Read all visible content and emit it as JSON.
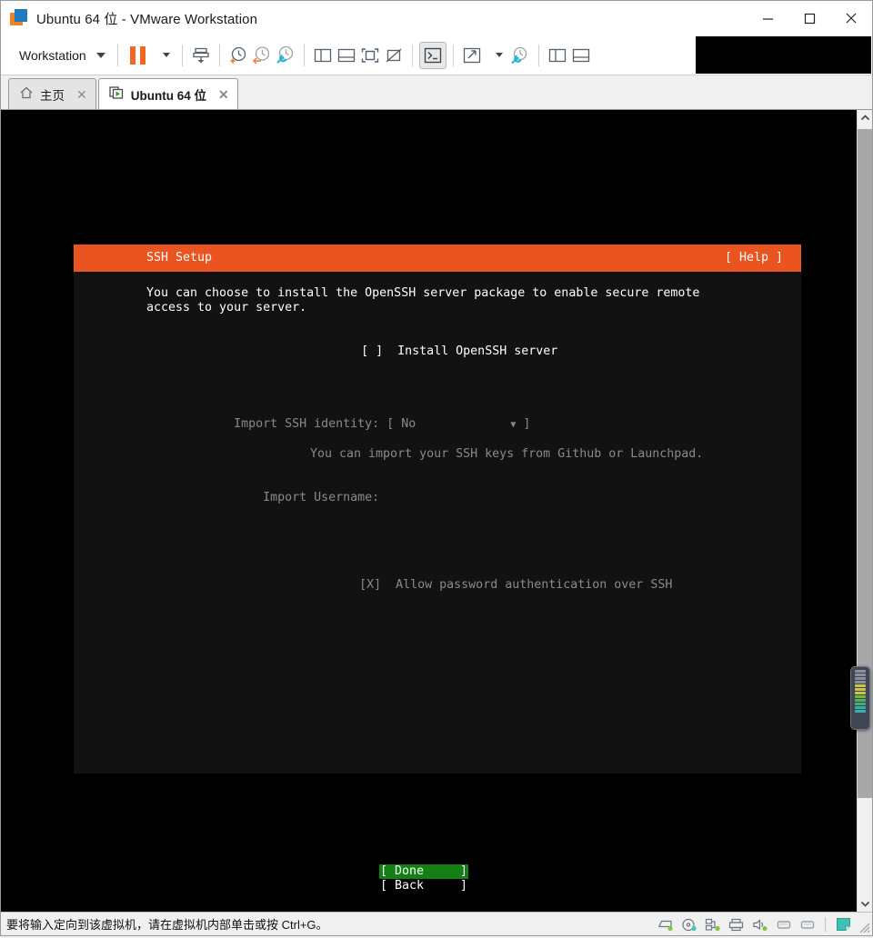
{
  "window": {
    "title": "Ubuntu 64 位 - VMware Workstation",
    "logo_icon": "vmware-logo-icon",
    "minimize_icon": "minimize-icon",
    "maximize_icon": "maximize-icon",
    "close_icon": "close-icon"
  },
  "toolbar": {
    "workstation_label": "Workstation",
    "workstation_caret_icon": "chevron-down-icon",
    "pause_icon": "pause-icon",
    "pause_caret_icon": "chevron-down-icon",
    "send_ctrl_alt_del_icon": "send-key-icon",
    "snapshot_take_icon": "snapshot-add-icon",
    "snapshot_revert_icon": "snapshot-revert-icon",
    "snapshot_manager_icon": "snapshot-manager-icon",
    "show_two_pane_icon": "panel-left-icon",
    "show_bottom_pane_icon": "panel-bottom-icon",
    "fit_guest_icon": "fit-guest-icon",
    "autofit_off_icon": "autofit-off-icon",
    "console_view_icon": "console-view-icon",
    "fullscreen_icon": "fullscreen-icon",
    "fullscreen_caret_icon": "chevron-down-icon",
    "unity_icon": "unity-mode-icon",
    "settings_icon": "vm-settings-icon",
    "library_icon": "library-panel-icon",
    "thumbnail_icon": "thumbnail-bar-icon"
  },
  "tabs": [
    {
      "label": "主页",
      "icon": "home-icon",
      "active": false,
      "close_icon": "close-icon"
    },
    {
      "label": "Ubuntu 64 位",
      "icon": "vm-power-icon",
      "active": true,
      "close_icon": "close-icon"
    }
  ],
  "installer": {
    "header_title": "SSH Setup",
    "help_button": "[ Help ]",
    "description_line1": "You can choose to install the OpenSSH server package to enable secure remote",
    "description_line2": "access to your server.",
    "install_checkbox_mark": "[ ]",
    "install_checkbox_label": "Install OpenSSH server",
    "import_identity_label": "Import SSH identity:",
    "import_identity_open": "[",
    "import_identity_value": "No",
    "import_identity_caret": "▼",
    "import_identity_close": "]",
    "import_identity_hint": "You can import your SSH keys from Github or Launchpad.",
    "import_username_label": "Import Username:",
    "allow_password_mark": "[X]",
    "allow_password_label": "Allow password authentication over SSH",
    "done_button": "[ Done     ]",
    "back_button": "[ Back     ]",
    "colors": {
      "header_orange": "#e95420",
      "screen_black": "#121212",
      "dim_text": "#8a8a8a",
      "selected_green": "#148014"
    }
  },
  "scrollbar": {
    "up_arrow_icon": "chevron-up-icon",
    "down_arrow_icon": "chevron-down-icon"
  },
  "level_meter": {
    "name": "level-meter-widget",
    "segments": [
      "#8a90a0",
      "#8a90a0",
      "#8a90a0",
      "#8a90a0",
      "#c9c44a",
      "#c9c44a",
      "#c9c44a",
      "#7ab43c",
      "#4fb05a",
      "#3fae72",
      "#38b0a0",
      "#35b3b0"
    ]
  },
  "statusbar": {
    "message": "要将输入定向到该虚拟机，请在虚拟机内部单击或按 Ctrl+G。",
    "icons": [
      "hard-disk-icon",
      "cd-dvd-icon",
      "network-adapter-icon",
      "printer-icon",
      "sound-card-icon",
      "usb-device-icon",
      "usb-device-icon",
      "note-icon"
    ],
    "resize_grip_icon": "resize-grip-icon"
  }
}
